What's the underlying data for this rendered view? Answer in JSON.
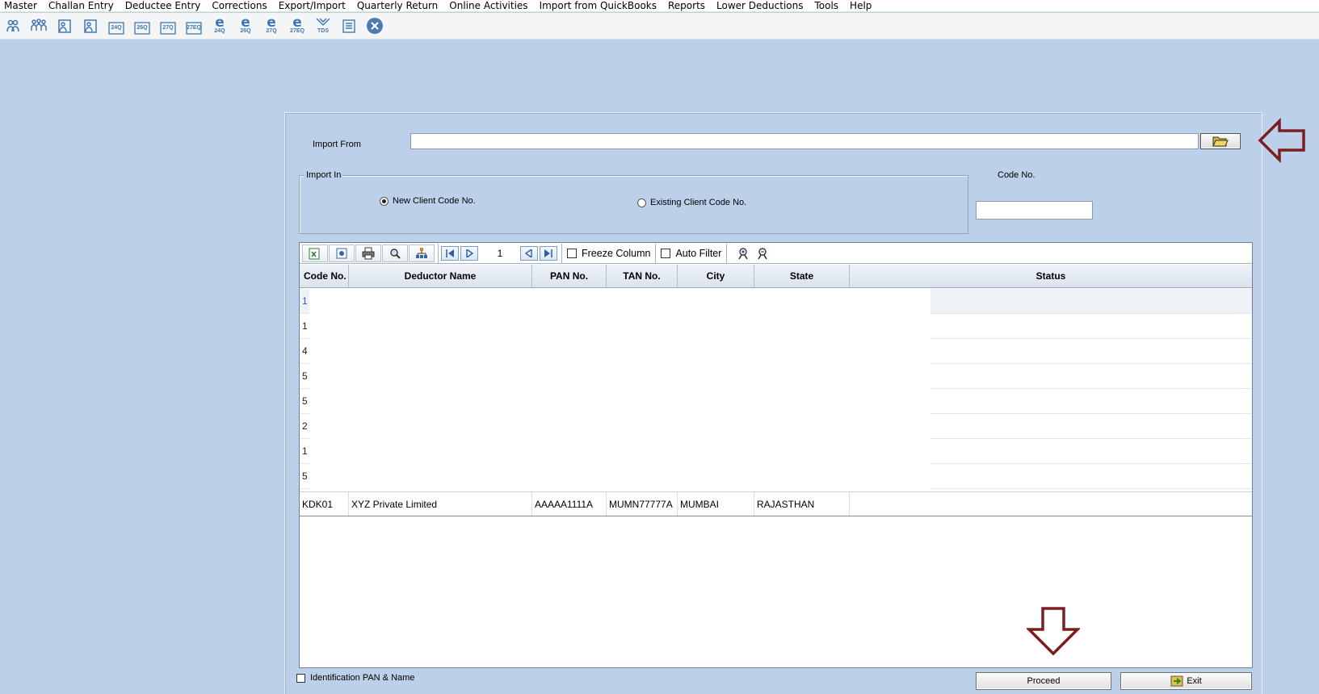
{
  "menu": [
    "Master",
    "Challan Entry",
    "Deductee Entry",
    "Corrections",
    "Export/Import",
    "Quarterly Return",
    "Online Activities",
    "Import from QuickBooks",
    "Reports",
    "Lower Deductions",
    "Tools",
    "Help"
  ],
  "toolbar": {
    "labels": [
      "24Q",
      "26Q",
      "27Q",
      "27EQ",
      "24Q",
      "26Q",
      "27Q",
      "27EQ",
      "TDS"
    ]
  },
  "form": {
    "import_from_label": "Import From",
    "import_from_value": "",
    "import_in_label": "Import In",
    "radio_new": "New Client Code No.",
    "radio_existing": "Existing Client Code No.",
    "code_no_label": "Code No.",
    "code_no_value": ""
  },
  "grid": {
    "page": "1",
    "freeze_column": "Freeze Column",
    "auto_filter": "Auto Filter",
    "columns": [
      "Code No.",
      "Deductor Name",
      "PAN No.",
      "TAN No.",
      "City",
      "State",
      "Status"
    ],
    "partial_rows": [
      "1",
      "1",
      "4",
      "5",
      "5",
      "2",
      "1",
      "5"
    ],
    "row": {
      "code": "KDK01",
      "name": "XYZ Private Limited",
      "pan": "AAAAA1111A",
      "tan": "MUMN77777A",
      "city": "MUMBAI",
      "state": "RAJASTHAN",
      "status": ""
    }
  },
  "footer": {
    "identification": "Identification PAN & Name",
    "proceed": "Proceed",
    "exit": "Exit"
  },
  "colors": {
    "background": "#bcd0ea",
    "arrow": "#7a1f1f",
    "icon": "#3f78b6"
  }
}
